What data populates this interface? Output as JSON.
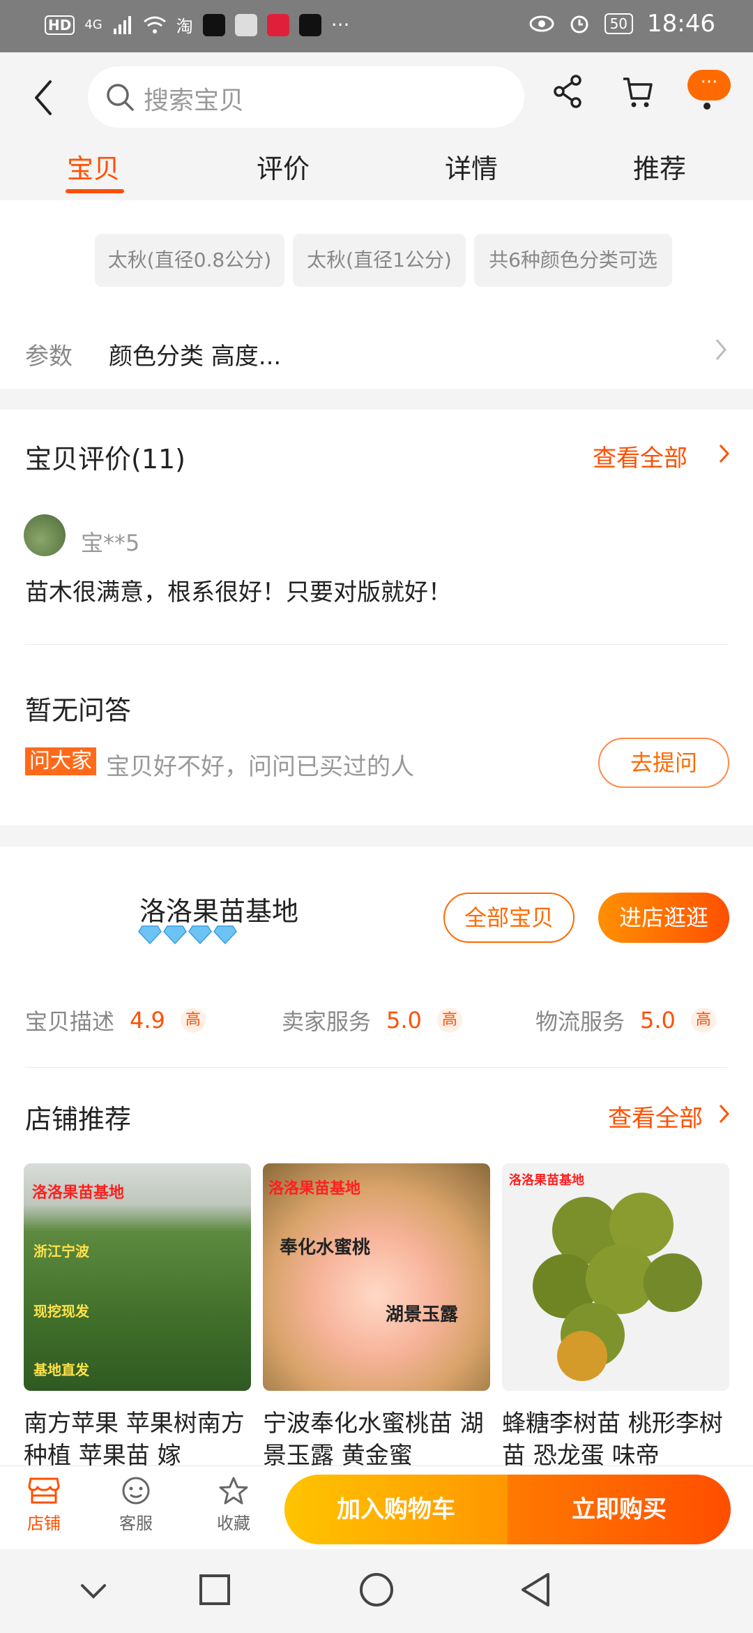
{
  "status_bar": {
    "left_labels": [
      "HD",
      "4G"
    ],
    "icons": [
      "signal-icon",
      "wifi-icon",
      "taobao-icon",
      "tiktok-icon",
      "huawei-icon",
      "pinduoduo-icon",
      "tiktok-icon",
      "more-dots-icon"
    ],
    "battery": "50",
    "time": "18:46"
  },
  "header": {
    "search_placeholder": "搜索宝贝",
    "more_badge": "···",
    "tabs": [
      {
        "label": "宝贝",
        "active": true
      },
      {
        "label": "评价",
        "active": false
      },
      {
        "label": "详情",
        "active": false
      },
      {
        "label": "推荐",
        "active": false
      }
    ]
  },
  "options": {
    "pills": [
      "太秋(直径0.8公分)",
      "太秋(直径1公分)",
      "共6种颜色分类可选"
    ],
    "params_label": "参数",
    "params_value": "颜色分类 高度..."
  },
  "reviews": {
    "title": "宝贝评价(11)",
    "view_all": "查看全部",
    "reviewer": "宝**5",
    "review_text": "苗木很满意，根系很好！只要对版就好！",
    "qa_title": "暂无问答",
    "ask_tag": "问大家",
    "ask_prompt": "宝贝好不好，问问已买过的人",
    "ask_button": "去提问"
  },
  "shop": {
    "name": "洛洛果苗基地",
    "rating_icons": [
      "diamond-icon",
      "diamond-icon",
      "diamond-icon",
      "diamond-icon"
    ],
    "all_items_button": "全部宝贝",
    "enter_shop_button": "进店逛逛",
    "scores": [
      {
        "label": "宝贝描述",
        "value": "4.9",
        "level": "高"
      },
      {
        "label": "卖家服务",
        "value": "5.0",
        "level": "高"
      },
      {
        "label": "物流服务",
        "value": "5.0",
        "level": "高"
      }
    ]
  },
  "recommend": {
    "title": "店铺推荐",
    "view_all": "查看全部",
    "products": [
      {
        "title": "南方苹果 苹果树南方种植 苹果苗 嫁",
        "tags": [
          "洛洛果苗基地",
          "浙江宁波",
          "现挖现发",
          "基地直发"
        ]
      },
      {
        "title": "宁波奉化水蜜桃苗 湖景玉露 黄金蜜",
        "tags": [
          "洛洛果苗基地",
          "奉化水蜜桃",
          "湖景玉露"
        ]
      },
      {
        "title": "蜂糖李树苗 桃形李树苗 恐龙蛋 味帝",
        "tags": [
          "洛洛果苗基地"
        ]
      }
    ]
  },
  "bottom_bar": {
    "shop_label": "店铺",
    "service_label": "客服",
    "favorite_label": "收藏",
    "add_to_cart": "加入购物车",
    "buy_now": "立即购买"
  },
  "colors": {
    "accent": "#ff5000",
    "accent_light": "#ff9000",
    "cart_gradient_start": "#ffc400",
    "status_bar": "#7d7d7d"
  }
}
